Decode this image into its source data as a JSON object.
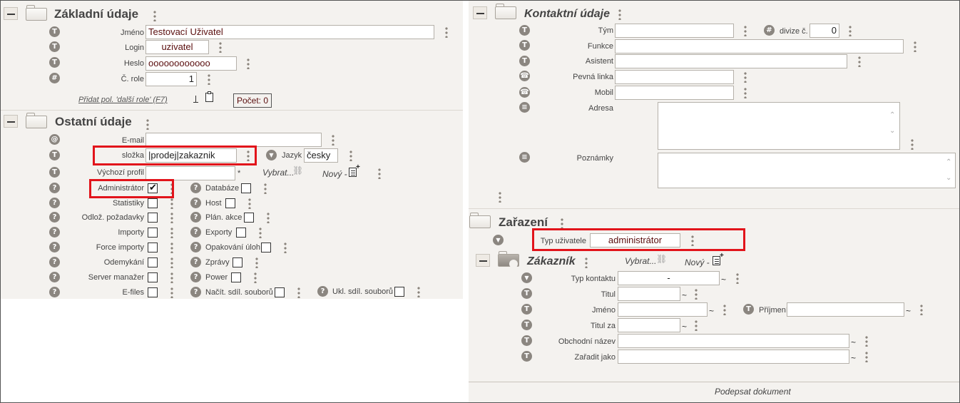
{
  "left": {
    "zakladni": {
      "title": "Základní údaje",
      "jmeno_label": "Jméno",
      "jmeno_value": "Testovací Uživatel",
      "login_label": "Login",
      "login_value": "uzivatel",
      "heslo_label": "Heslo",
      "heslo_value": "oooooooooooo",
      "crole_label": "Č. role",
      "crole_value": "1",
      "add_role_link": "Přidat pol. 'další role' (F7)",
      "count_label": "Počet: 0"
    },
    "ostatni": {
      "title": "Ostatní údaje",
      "email_label": "E-mail",
      "email_value": "",
      "slozka_label": "složka",
      "slozka_value": "|prodej|zakaznik",
      "jazyk_label": "Jazyk",
      "jazyk_value": "česky",
      "profil_label": "Výchozí profil",
      "profil_value": "",
      "profil_star": "*",
      "vybrat_label": "Vybrat...",
      "novy_label": "Nový -",
      "checks_col1": [
        {
          "label": "Administrátor",
          "checked": true
        },
        {
          "label": "Statistiky",
          "checked": false
        },
        {
          "label": "Odlož. požadavky",
          "checked": false
        },
        {
          "label": "Importy",
          "checked": false
        },
        {
          "label": "Force importy",
          "checked": false
        },
        {
          "label": "Odemykání",
          "checked": false
        },
        {
          "label": "Server manažer",
          "checked": false
        },
        {
          "label": "E-files",
          "checked": false
        }
      ],
      "checks_col2": [
        {
          "label": "Databáze",
          "checked": false
        },
        {
          "label": "Host",
          "checked": false
        },
        {
          "label": "Plán. akce",
          "checked": false
        },
        {
          "label": "Exporty",
          "checked": false
        },
        {
          "label": "Opakování úloh",
          "checked": false
        },
        {
          "label": "Zprávy",
          "checked": false
        },
        {
          "label": "Power",
          "checked": false
        },
        {
          "label": "Načít. sdíl. souborů",
          "checked": false
        }
      ],
      "ukl_label": "Ukl. sdíl. souborů"
    }
  },
  "right": {
    "kontaktni": {
      "title": "Kontaktní údaje",
      "tym_label": "Tým",
      "tym_value": "",
      "divize_label": "divize č.",
      "divize_value": "0",
      "funkce_label": "Funkce",
      "funkce_value": "",
      "asistent_label": "Asistent",
      "asistent_value": "",
      "pevna_label": "Pevná linka",
      "pevna_value": "",
      "mobil_label": "Mobil",
      "mobil_value": "",
      "adresa_label": "Adresa",
      "poznamky_label": "Poznámky"
    },
    "zarazeni": {
      "title": "Zařazení",
      "typ_label": "Typ uživatele",
      "typ_value": "administrátor"
    },
    "zakaznik": {
      "title": "Zákazník",
      "vybrat_label": "Vybrat...",
      "novy_label": "Nový -",
      "typ_kontaktu_label": "Typ kontaktu",
      "typ_kontaktu_value": "-",
      "titul_label": "Titul",
      "titul_value": "",
      "jmeno_label": "Jméno",
      "jmeno_value": "",
      "prijmeni_label": "Příjmení",
      "prijmeni_value": "",
      "titul_za_label": "Titul za",
      "titul_za_value": "",
      "obchodni_label": "Obchodní název",
      "obchodni_value": "",
      "zaradit_label": "Zařadit jako",
      "zaradit_value": ""
    },
    "footer": {
      "sign_label": "Podepsat dokument"
    }
  },
  "icons": {
    "text": "T",
    "number": "#",
    "email": "@",
    "help": "?",
    "phone": "☎",
    "note": "≡",
    "dropdown": "▼",
    "tilde": "~"
  },
  "colors": {
    "highlight": "#e2141b",
    "panel": "#f4f2ef",
    "value_text": "#5a0e0e"
  }
}
